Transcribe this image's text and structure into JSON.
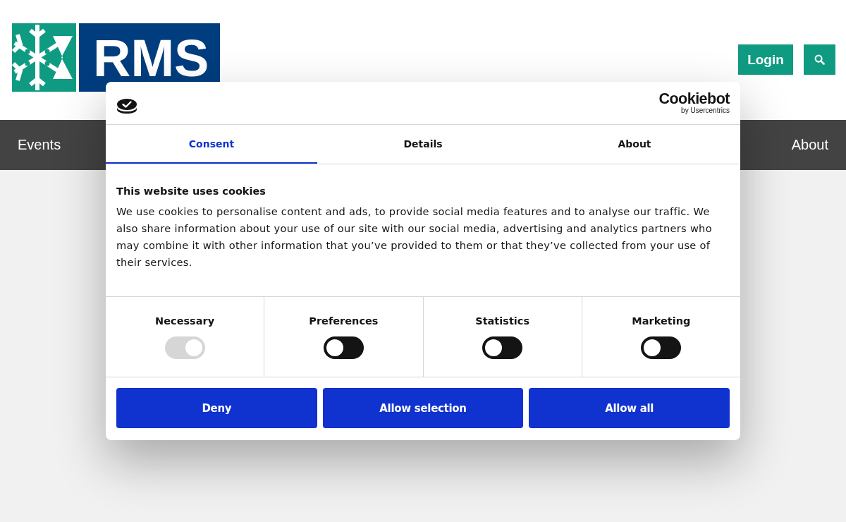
{
  "header": {
    "logo": {
      "text": "RMS"
    },
    "login": {
      "label": "Login"
    }
  },
  "nav": {
    "items": [
      {
        "label": "Events"
      },
      {
        "label": "About"
      }
    ]
  },
  "cookie_dialog": {
    "brand": {
      "name": "Cookiebot",
      "tagline": "by Usercentrics"
    },
    "tabs": [
      {
        "label": "Consent",
        "selected": true
      },
      {
        "label": "Details",
        "selected": false
      },
      {
        "label": "About",
        "selected": false
      }
    ],
    "title": "This website uses cookies",
    "text": "We use cookies to personalise content and ads, to provide social media features and to analyse our traffic. We also share information about your use of our site with our social media, advertising and analytics partners who may combine it with other information that you’ve provided to them or that they’ve collected from your use of their services.",
    "categories": [
      {
        "label": "Necessary",
        "checked": true,
        "disabled": true
      },
      {
        "label": "Preferences",
        "checked": false,
        "disabled": false
      },
      {
        "label": "Statistics",
        "checked": false,
        "disabled": false
      },
      {
        "label": "Marketing",
        "checked": false,
        "disabled": false
      }
    ],
    "buttons": [
      {
        "label": "Deny"
      },
      {
        "label": "Allow selection"
      },
      {
        "label": "Allow all"
      }
    ]
  }
}
